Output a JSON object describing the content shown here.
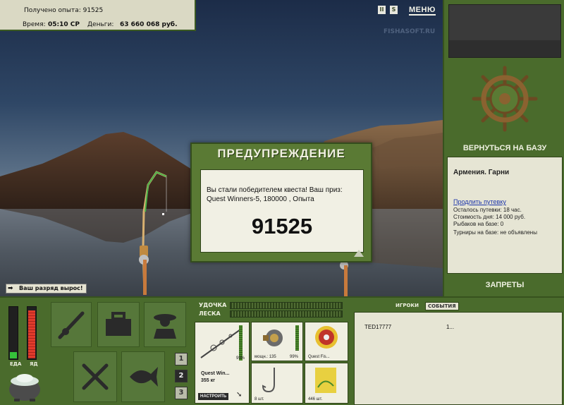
{
  "info": {
    "exp_line": "Получено опыта: 91525",
    "time_label": "Время:",
    "time_value": "05:10 СР",
    "money_label": "Деньги:",
    "money_value": "63 660 068 руб."
  },
  "top_icons": [
    "II",
    "S"
  ],
  "menu_label": "МЕНЮ",
  "watermark": "FISHASOFT.RU",
  "rank_note": "Ваш разряд вырос!",
  "dialog": {
    "title": "ПРЕДУПРЕЖДЕНИЕ",
    "message": "Вы стали победителем квеста! Ваш приз: Quest Winners-5, 180000 , Опыта",
    "number": "91525"
  },
  "right_panel": {
    "return_label": "ВЕРНУТЬСЯ НА БАЗУ",
    "base_name": "Армения. Гарни",
    "extend_link": "Продлить путевку",
    "rows": [
      "Осталось путевки: 18 час.",
      "Стоимость дня: 14 000 руб.",
      "Рыбаков на базе: 0",
      "Турниры на базе: не объявлены"
    ],
    "bans_label": "ЗАПРЕТЫ"
  },
  "meters": {
    "left_label": "ЕДА",
    "right_label": "ЯД",
    "food_level": 0.12,
    "poison_level": 0.92
  },
  "slot_pages": [
    "1",
    "2",
    "3"
  ],
  "tackle": {
    "rod_label": "УДОЧКА",
    "line_label": "ЛЕСКА",
    "rod_name": "Quest Win...",
    "rod_weight": "355 кг",
    "rod_pct": "99%",
    "tune_label": "НАСТРОИТЬ",
    "reel_text": "мощн.: 135",
    "reel_pct": "99%",
    "line_name": "Quest Fis...",
    "hook_count": "8 шт.",
    "bait_count": "446 шт."
  },
  "players": {
    "tab_players": "ИГРОКИ",
    "tab_events": "СОБЫТИЯ",
    "rows": [
      {
        "name": "TED17777",
        "rank": "1..."
      }
    ]
  },
  "colors": {
    "panel_green": "#4a6b2c",
    "panel_light": "#e6e5d4",
    "dialog_green": "#5a7a34"
  }
}
